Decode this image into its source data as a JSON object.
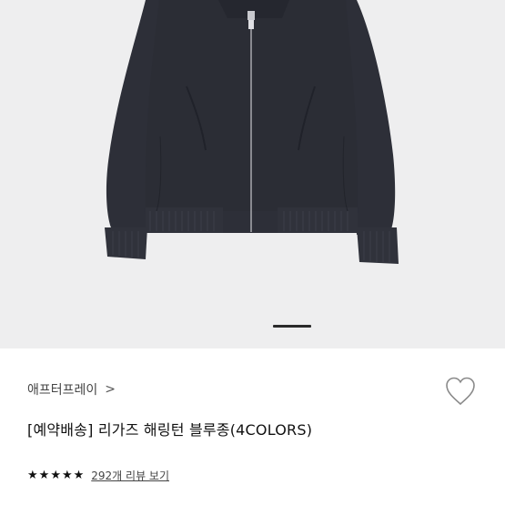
{
  "product": {
    "brand": "애프터프레이",
    "brand_chevron": ">",
    "title": "[예약배송] 리가즈 해링턴 블루종(4COLORS)",
    "rating": 5,
    "rating_max": 5,
    "review_link": "292개 리뷰 보기"
  },
  "gallery": {
    "active_indicator": 1
  },
  "icons": {
    "wishlist": "heart-outline-icon",
    "star": "star-filled-icon",
    "chevron": "chevron-right-icon"
  },
  "colors": {
    "jacket": "#2b2d35",
    "hero_bg": "#eeeeef"
  }
}
